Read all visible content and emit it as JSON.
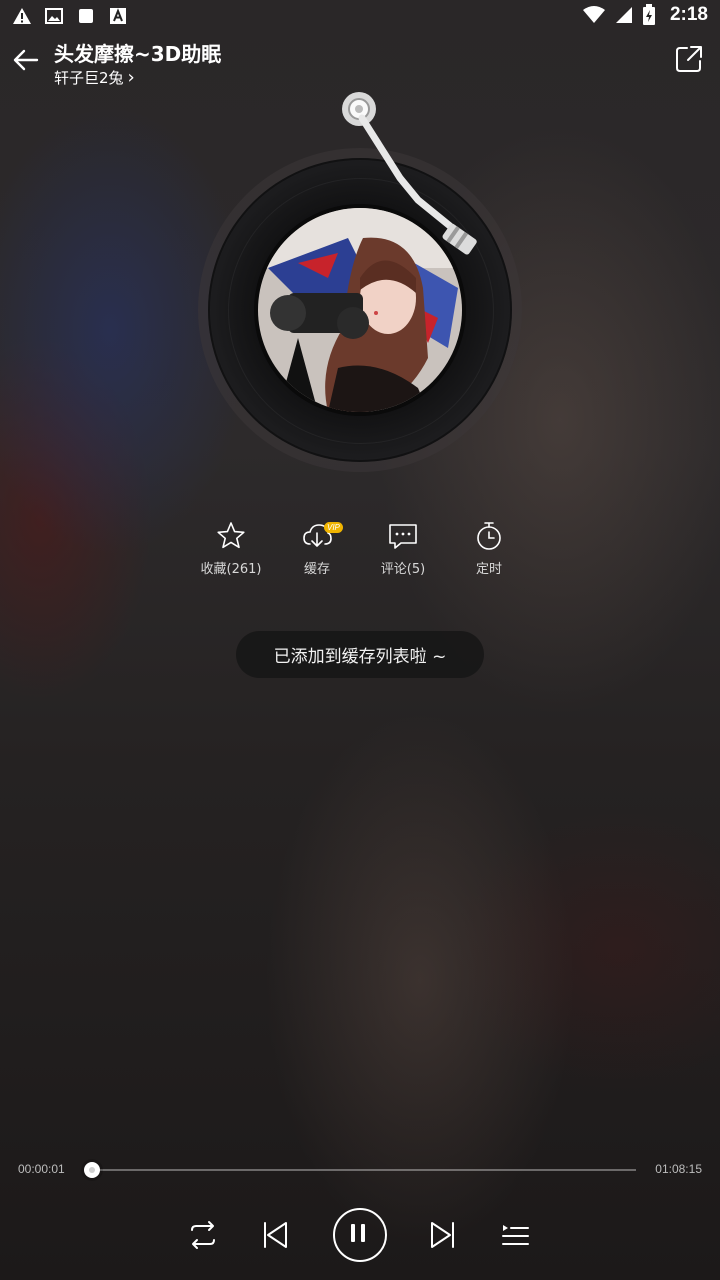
{
  "status_bar": {
    "time": "2:18",
    "left_icons": [
      "warning-icon",
      "image-icon",
      "square-icon",
      "font-icon"
    ],
    "right_icons": [
      "wifi-icon",
      "signal-icon",
      "battery-icon"
    ]
  },
  "header": {
    "title": "头发摩擦~3D助眠",
    "artist": "轩子巨2兔",
    "artist_chevron": "›"
  },
  "actions": [
    {
      "label": "收藏(261)",
      "icon": "star-icon"
    },
    {
      "label": "缓存",
      "icon": "download-cloud-icon",
      "badge": "VIP"
    },
    {
      "label": "评论(5)",
      "icon": "comment-icon"
    },
    {
      "label": "定时",
      "icon": "timer-icon"
    }
  ],
  "toast": {
    "text": "已添加到缓存列表啦 ~"
  },
  "playback": {
    "elapsed": "00:00:01",
    "duration": "01:08:15",
    "progress_fraction": 0.0002
  },
  "controls": [
    "repeat-icon",
    "previous-icon",
    "pause-icon",
    "next-icon",
    "playlist-icon"
  ],
  "colors": {
    "accent": "#ffffff",
    "vip_badge": "#f0b400"
  }
}
